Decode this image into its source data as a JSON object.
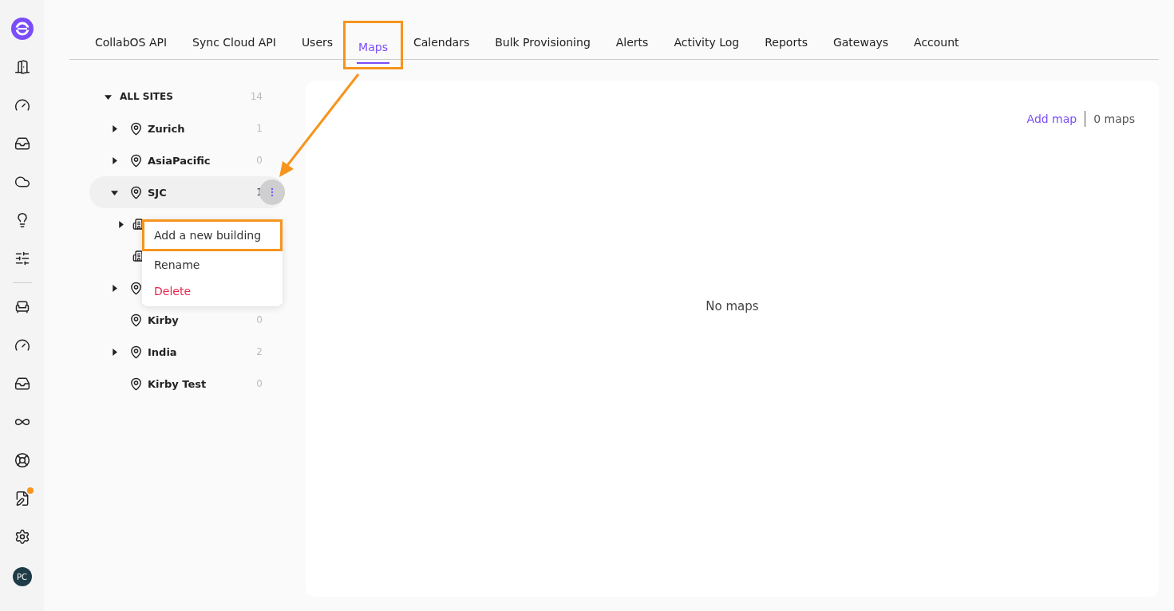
{
  "sidebar": {
    "items": [
      {
        "kind": "door"
      },
      {
        "kind": "gauge"
      },
      {
        "kind": "alert"
      },
      {
        "kind": "cloud"
      },
      {
        "kind": "bulb"
      },
      {
        "kind": "sliders"
      },
      {
        "kind": "divider"
      },
      {
        "kind": "chair"
      },
      {
        "kind": "gauge"
      },
      {
        "kind": "alert"
      },
      {
        "kind": "link"
      },
      {
        "kind": "lifebuoy"
      },
      {
        "kind": "report",
        "badge": true
      },
      {
        "kind": "settings"
      }
    ],
    "avatar": "PC"
  },
  "tabs": [
    {
      "label": "CollabOS API",
      "selected": false,
      "highlighted": false
    },
    {
      "label": "Sync Cloud API",
      "selected": false,
      "highlighted": false
    },
    {
      "label": "Users",
      "selected": false,
      "highlighted": false
    },
    {
      "label": "Maps",
      "selected": true,
      "highlighted": true
    },
    {
      "label": "Calendars",
      "selected": false,
      "highlighted": false
    },
    {
      "label": "Bulk Provisioning",
      "selected": false,
      "highlighted": false
    },
    {
      "label": "Alerts",
      "selected": false,
      "highlighted": false
    },
    {
      "label": "Activity Log",
      "selected": false,
      "highlighted": false
    },
    {
      "label": "Reports",
      "selected": false,
      "highlighted": false
    },
    {
      "label": "Gateways",
      "selected": false,
      "highlighted": false
    },
    {
      "label": "Account",
      "selected": false,
      "highlighted": false
    }
  ],
  "tree": {
    "label": "ALL SITES",
    "count": "14",
    "expanded": true,
    "children": [
      {
        "kind": "site",
        "name": "Zurich",
        "count": "1",
        "expanded": false
      },
      {
        "kind": "site",
        "name": "AsiaPacific",
        "count": "0",
        "expanded": false
      },
      {
        "kind": "site",
        "name": "SJC",
        "count": "1",
        "expanded": true,
        "menu_open": true,
        "children": [
          {
            "kind": "building",
            "expanded": false
          },
          {
            "kind": "building"
          }
        ]
      },
      {
        "kind": "site",
        "expanded": false
      },
      {
        "kind": "site",
        "name": "Kirby",
        "count": "0"
      },
      {
        "kind": "site",
        "name": "India",
        "count": "2",
        "expanded": false
      },
      {
        "kind": "site",
        "name": "Kirby Test",
        "count": "0"
      }
    ]
  },
  "context_menu": {
    "items": [
      {
        "label": "Add a new building",
        "kind": "normal",
        "highlighted": true
      },
      {
        "label": "Rename",
        "kind": "normal",
        "highlighted": false
      },
      {
        "label": "Delete",
        "kind": "danger",
        "highlighted": false
      }
    ]
  },
  "maps_panel": {
    "add_link": "Add map",
    "count": "0 maps",
    "empty_text": "No maps"
  },
  "annotation_arrow": true
}
